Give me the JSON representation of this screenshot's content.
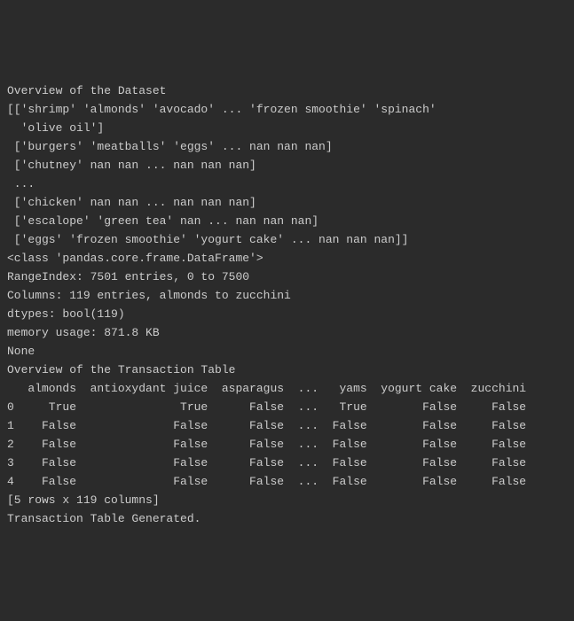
{
  "lines": [
    "Overview of the Dataset",
    "[['shrimp' 'almonds' 'avocado' ... 'frozen smoothie' 'spinach'",
    "  'olive oil']",
    " ['burgers' 'meatballs' 'eggs' ... nan nan nan]",
    " ['chutney' nan nan ... nan nan nan]",
    " ...",
    " ['chicken' nan nan ... nan nan nan]",
    " ['escalope' 'green tea' nan ... nan nan nan]",
    " ['eggs' 'frozen smoothie' 'yogurt cake' ... nan nan nan]]",
    "<class 'pandas.core.frame.DataFrame'>",
    "RangeIndex: 7501 entries, 0 to 7500",
    "Columns: 119 entries, almonds to zucchini",
    "dtypes: bool(119)",
    "memory usage: 871.8 KB",
    "None",
    "",
    "Overview of the Transaction Table",
    "   almonds  antioxydant juice  asparagus  ...   yams  yogurt cake  zucchini",
    "0     True               True      False  ...   True        False     False",
    "1    False              False      False  ...  False        False     False",
    "2    False              False      False  ...  False        False     False",
    "3    False              False      False  ...  False        False     False",
    "4    False              False      False  ...  False        False     False",
    "",
    "[5 rows x 119 columns]",
    "Transaction Table Generated."
  ]
}
